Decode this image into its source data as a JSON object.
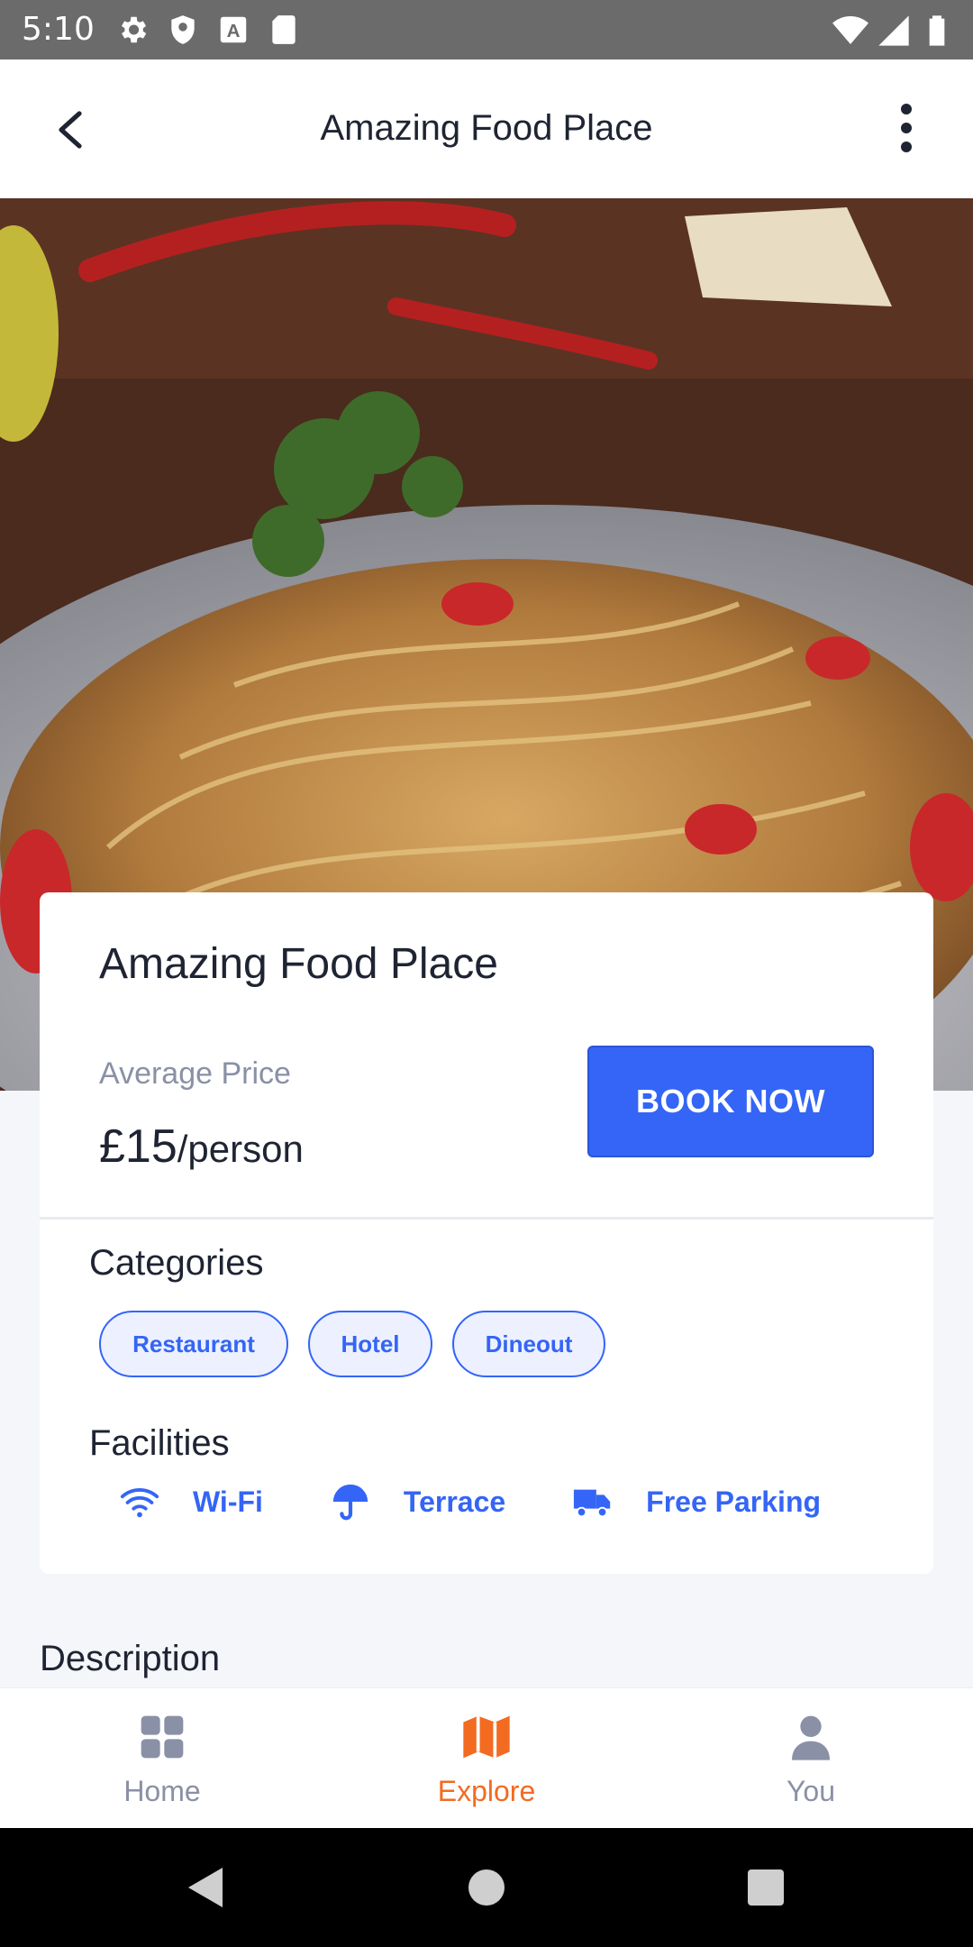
{
  "status_bar": {
    "time": "5:10"
  },
  "app_bar": {
    "title": "Amazing Food Place"
  },
  "card": {
    "title": "Amazing Food Place",
    "avg_price_label": "Average Price",
    "price": "£15",
    "price_unit": "/person",
    "book_button": "BOOK NOW"
  },
  "categories": {
    "heading": "Categories",
    "items": [
      "Restaurant",
      "Hotel",
      "Dineout"
    ]
  },
  "facilities": {
    "heading": "Facilities",
    "items": [
      {
        "label": "Wi-Fi",
        "icon": "wifi-icon"
      },
      {
        "label": "Terrace",
        "icon": "umbrella-icon"
      },
      {
        "label": "Free Parking",
        "icon": "truck-icon"
      }
    ]
  },
  "description": {
    "heading": "Description"
  },
  "bottom_nav": {
    "items": [
      {
        "label": "Home",
        "icon": "grid-icon"
      },
      {
        "label": "Explore",
        "icon": "map-icon",
        "active": true
      },
      {
        "label": "You",
        "icon": "person-icon"
      }
    ]
  },
  "colors": {
    "accent": "#3465f6",
    "active_nav": "#f26b21",
    "muted": "#8a90a6"
  }
}
